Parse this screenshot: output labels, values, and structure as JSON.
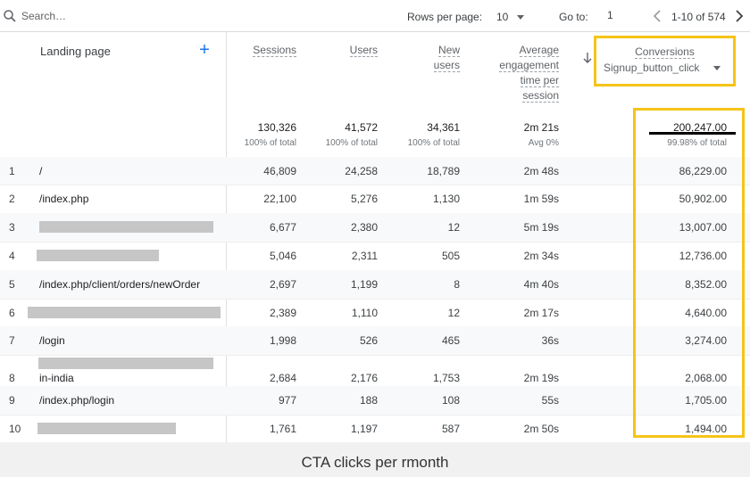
{
  "toolbar": {
    "search_placeholder": "Search…",
    "rows_per_page_label": "Rows per page:",
    "rows_per_page_value": "10",
    "goto_label": "Go to:",
    "goto_value": "1",
    "page_range": "1-10 of 574"
  },
  "header": {
    "dimension": "Landing page",
    "metrics": {
      "sessions": "Sessions",
      "users": "Users",
      "new_users_1": "New",
      "new_users_2": "users",
      "aet_1": "Average",
      "aet_2": "engagement",
      "aet_3": "time per",
      "aet_4": "session",
      "conversions": "Conversions",
      "conversion_event": "Signup_button_click"
    }
  },
  "totals": {
    "sessions": "130,326",
    "sessions_sub": "100% of total",
    "users": "41,572",
    "users_sub": "100% of total",
    "new_users": "34,361",
    "new_users_sub": "100% of total",
    "aet": "2m 21s",
    "aet_sub": "Avg 0%",
    "conversions": "200,247.00",
    "conversions_sub": "99.98% of total"
  },
  "rows": [
    {
      "n": "1",
      "page": "/",
      "sessions": "46,809",
      "users": "24,258",
      "new_users": "18,789",
      "aet": "2m 48s",
      "conv": "86,229.00"
    },
    {
      "n": "2",
      "page": "/index.php",
      "sessions": "22,100",
      "users": "5,276",
      "new_users": "1,130",
      "aet": "1m 59s",
      "conv": "50,902.00"
    },
    {
      "n": "3",
      "page": "",
      "sessions": "6,677",
      "users": "2,380",
      "new_users": "12",
      "aet": "5m 19s",
      "conv": "13,007.00"
    },
    {
      "n": "4",
      "page": "",
      "sessions": "5,046",
      "users": "2,311",
      "new_users": "505",
      "aet": "2m 34s",
      "conv": "12,736.00"
    },
    {
      "n": "5",
      "page": "/index.php/client/orders/newOrder",
      "sessions": "2,697",
      "users": "1,199",
      "new_users": "8",
      "aet": "4m 40s",
      "conv": "8,352.00"
    },
    {
      "n": "6",
      "page": "",
      "sessions": "2,389",
      "users": "1,110",
      "new_users": "12",
      "aet": "2m 17s",
      "conv": "4,640.00"
    },
    {
      "n": "7",
      "page": "/login",
      "sessions": "1,998",
      "users": "526",
      "new_users": "465",
      "aet": "36s",
      "conv": "3,274.00"
    },
    {
      "n": "8",
      "page": "in-india",
      "sessions": "2,684",
      "users": "2,176",
      "new_users": "1,753",
      "aet": "2m 19s",
      "conv": "2,068.00"
    },
    {
      "n": "9",
      "page": "/index.php/login",
      "sessions": "977",
      "users": "188",
      "new_users": "108",
      "aet": "55s",
      "conv": "1,705.00"
    },
    {
      "n": "10",
      "page": "",
      "sessions": "1,761",
      "users": "1,197",
      "new_users": "587",
      "aet": "2m 50s",
      "conv": "1,494.00"
    }
  ],
  "caption": "CTA clicks per rmonth",
  "colors": {
    "highlight": "#f6c417",
    "accent": "#1a73e8"
  }
}
